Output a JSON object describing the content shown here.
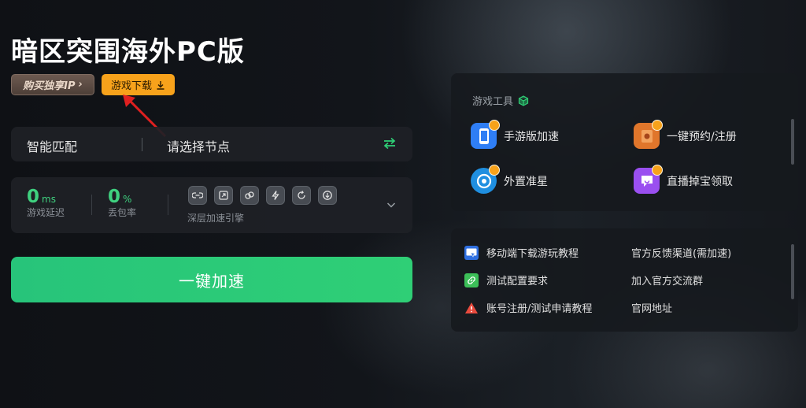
{
  "app": {
    "title": "暗区突围海外PC版",
    "buy_ip_label": "购买独享IP",
    "download_label": "游戏下载"
  },
  "node": {
    "mode": "智能匹配",
    "select_placeholder": "请选择节点"
  },
  "stats": {
    "latency_value": "0",
    "latency_unit": "ms",
    "latency_label": "游戏延迟",
    "loss_value": "0",
    "loss_unit": "%",
    "loss_label": "丢包率",
    "engine_label": "深层加速引擎"
  },
  "accelerate_label": "一键加速",
  "tools": {
    "title": "游戏工具",
    "items": [
      {
        "label": "手游版加速",
        "icon": "phone-icon",
        "color": "#2f7ef5"
      },
      {
        "label": "一键预约/注册",
        "icon": "reserve-icon",
        "color": "#e0762b"
      },
      {
        "label": "外置准星",
        "icon": "crosshair-icon",
        "color": "#1f8fe0"
      },
      {
        "label": "直播掉宝领取",
        "icon": "live-drop-icon",
        "color": "#9a4ff0"
      }
    ]
  },
  "links": {
    "items": [
      {
        "label": "移动端下载游玩教程",
        "icon": "www-icon"
      },
      {
        "label": "官方反馈渠道(需加速)"
      },
      {
        "label": "测试配置要求",
        "icon": "link-icon"
      },
      {
        "label": "加入官方交流群"
      },
      {
        "label": "账号注册/测试申请教程",
        "icon": "warning-icon"
      },
      {
        "label": "官网地址"
      }
    ]
  },
  "colors": {
    "accent_green": "#2fcf76",
    "download_orange": "#f7a21b",
    "stat_green": "#3fd07f"
  }
}
